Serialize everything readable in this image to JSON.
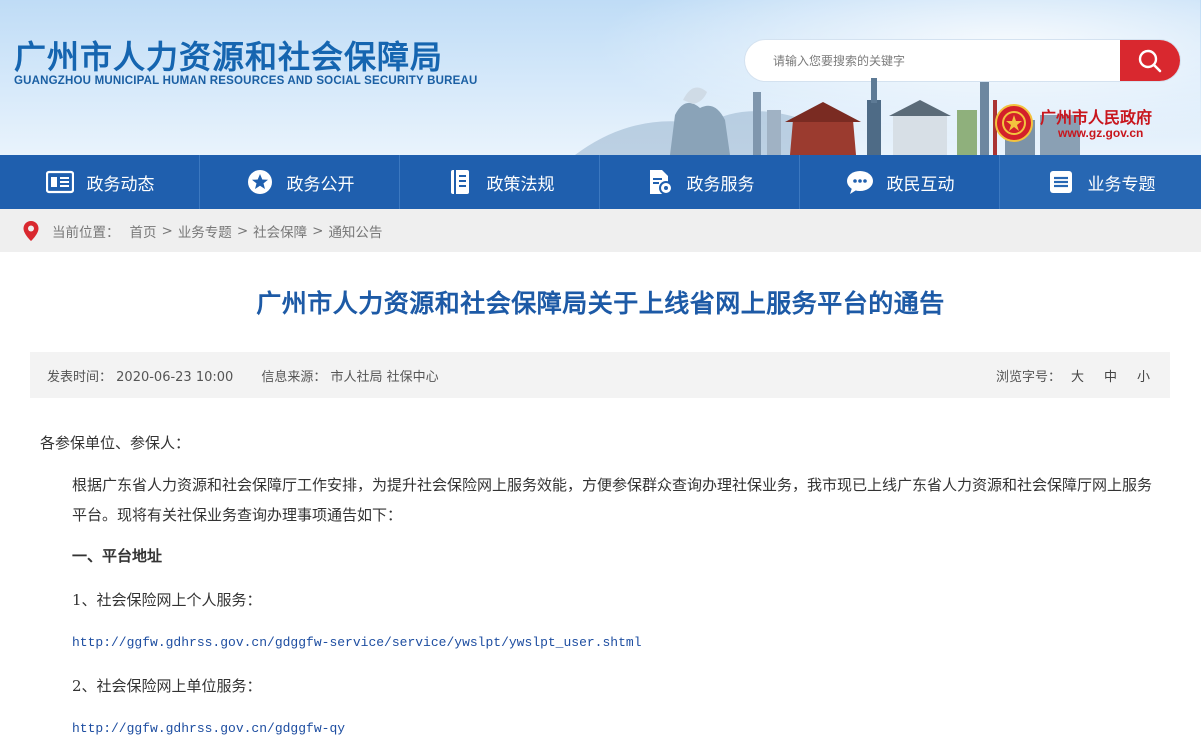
{
  "header": {
    "title": "广州市人力资源和社会保障局",
    "subtitle": "GUANGZHOU MUNICIPAL HUMAN RESOURCES AND SOCIAL SECURITY BUREAU",
    "search": {
      "placeholder": "请输入您要搜索的关键字",
      "value": ""
    },
    "gov_name": "广州市人民政府",
    "gov_url": "www.gz.gov.cn"
  },
  "nav": {
    "items": [
      {
        "label": "政务动态",
        "icon": "newspaper-icon"
      },
      {
        "label": "政务公开",
        "icon": "star-icon"
      },
      {
        "label": "政策法规",
        "icon": "book-icon"
      },
      {
        "label": "政务服务",
        "icon": "document-gear-icon"
      },
      {
        "label": "政民互动",
        "icon": "chat-icon"
      },
      {
        "label": "业务专题",
        "icon": "list-icon"
      }
    ]
  },
  "breadcrumb": {
    "prefix": "当前位置：",
    "items": [
      "首页",
      "业务专题",
      "社会保障",
      "通知公告"
    ],
    "separator": ">"
  },
  "article": {
    "title": "广州市人力资源和社会保障局关于上线省网上服务平台的通告",
    "meta": {
      "publish_label": "发表时间：",
      "publish_time": "2020-06-23 10:00",
      "source_label": "信息来源：",
      "source": "市人社局 社保中心",
      "fontsize_label": "浏览字号：",
      "fontsize_large": "大",
      "fontsize_medium": "中",
      "fontsize_small": "小"
    },
    "greeting": "各参保单位、参保人：",
    "intro": "根据广东省人力资源和社会保障厅工作安排，为提升社会保险网上服务效能，方便参保群众查询办理社保业务，我市现已上线广东省人力资源和社会保障厅网上服务平台。现将有关社保业务查询办理事项通告如下：",
    "section1": "一、平台地址",
    "item1": "1、社会保险网上个人服务：",
    "link1": "http://ggfw.gdhrss.gov.cn/gdggfw-service/service/ywslpt/ywslpt_user.shtml",
    "item2": "2、社会保险网上单位服务：",
    "link2": "http://ggfw.gdhrss.gov.cn/gdggfw-qy"
  },
  "colors": {
    "nav_bg": "#1f5fae",
    "title_blue": "#1d5aa6",
    "accent_red": "#d9282f"
  }
}
